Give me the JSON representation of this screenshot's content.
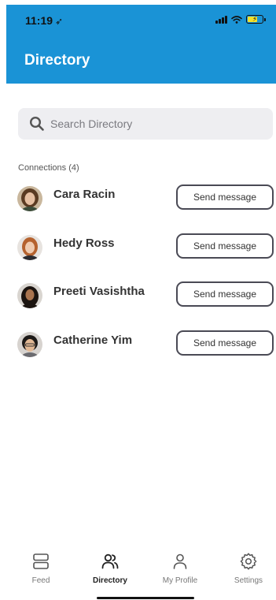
{
  "status_bar": {
    "time": "11:19",
    "location_glyph": "➶"
  },
  "header": {
    "title": "Directory"
  },
  "search": {
    "placeholder": "Search Directory"
  },
  "connections": {
    "label": "Connections (4)",
    "items": [
      {
        "name": "Cara Racin",
        "button": "Send message",
        "avatar_hair": "#5a3b22",
        "avatar_bg": "#c9b79d"
      },
      {
        "name": "Hedy Ross",
        "button": "Send message",
        "avatar_hair": "#b5622e",
        "avatar_bg": "#e7e3df"
      },
      {
        "name": "Preeti Vasishtha",
        "button": "Send message",
        "avatar_hair": "#1b1410",
        "avatar_bg": "#d9d5d0"
      },
      {
        "name": "Catherine Yim",
        "button": "Send message",
        "avatar_hair": "#1d1a18",
        "avatar_bg": "#d7d3cf"
      }
    ]
  },
  "tabbar": {
    "tabs": [
      {
        "label": "Feed",
        "icon": "feed-icon",
        "active": false
      },
      {
        "label": "Directory",
        "icon": "people-icon",
        "active": true
      },
      {
        "label": "My Profile",
        "icon": "person-icon",
        "active": false
      },
      {
        "label": "Settings",
        "icon": "gear-icon",
        "active": false
      }
    ]
  },
  "colors": {
    "header": "#1a93d6",
    "search_bg": "#eeeef1",
    "button_border": "#4a4a55"
  }
}
